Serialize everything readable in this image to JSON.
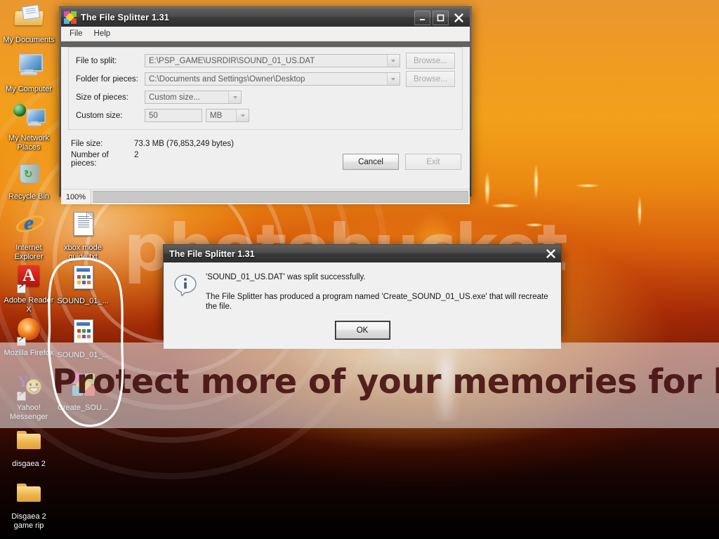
{
  "desktop": {
    "wallpaper_colors": {
      "top": "#e9972f",
      "mid": "#d8600d",
      "bottom": "#000000"
    },
    "icons": [
      {
        "label": "My Documents",
        "icon": "documents-folder-icon"
      },
      {
        "label": "My Computer",
        "icon": "computer-icon"
      },
      {
        "label": "My Network Places",
        "icon": "network-places-icon"
      },
      {
        "label": "Recycle Bin",
        "icon": "recycle-bin-icon"
      },
      {
        "label": "Internet Explorer",
        "icon": "internet-explorer-icon"
      },
      {
        "label": "Adobe Reader X",
        "icon": "adobe-reader-icon"
      },
      {
        "label": "Mozilla Firefox",
        "icon": "firefox-icon"
      },
      {
        "label": "Yahoo! Messenger",
        "icon": "yahoo-messenger-icon"
      },
      {
        "label": "disgaea 2",
        "icon": "folder-icon"
      },
      {
        "label": "Disgaea 2 game rip",
        "icon": "folder-icon"
      },
      {
        "label": "xbox mode guide.txt",
        "icon": "text-file-icon"
      },
      {
        "label": "SOUND_01_...",
        "icon": "dat-file-icon"
      },
      {
        "label": "SOUND_01_...",
        "icon": "dat-file-icon"
      },
      {
        "label": "Create_SOU...",
        "icon": "file-splitter-exe-icon"
      }
    ]
  },
  "watermark": {
    "word": "photobucket",
    "banner_text": "Protect more of your memories for less!"
  },
  "main_window": {
    "title": "The File Splitter 1.31",
    "icon": "file-splitter-icon",
    "window_buttons": {
      "minimize": "minimize-icon",
      "maximize": "maximize-icon",
      "close": "close-icon"
    },
    "menu": [
      {
        "label": "File"
      },
      {
        "label": "Help"
      }
    ],
    "fields": [
      {
        "label": "File to split:",
        "value": "E:\\PSP_GAME\\USRDIR\\SOUND_01_US.DAT",
        "control": "combo",
        "button": "Browse...",
        "disabled": true
      },
      {
        "label": "Folder for pieces:",
        "value": "C:\\Documents and Settings\\Owner\\Desktop",
        "control": "combo",
        "button": "Browse...",
        "disabled": true
      },
      {
        "label": "Size of pieces:",
        "value": "Custom size...",
        "control": "combo",
        "disabled": true
      }
    ],
    "custom_size": {
      "label": "Custom size:",
      "value": "50",
      "unit": "MB"
    },
    "status": {
      "file_size_label": "File size:",
      "file_size_value": "73.3 MB (76,853,249 bytes)",
      "pieces_label": "Number of pieces:",
      "pieces_value": "2"
    },
    "buttons": {
      "cancel": "Cancel",
      "exit": "Exit"
    },
    "progress": {
      "percent_label": "100%",
      "percent": 100
    }
  },
  "message_box": {
    "title": "The File Splitter 1.31",
    "close_icon": "close-icon",
    "info_icon": "information-icon",
    "line1": "'SOUND_01_US.DAT' was split successfully.",
    "line2": "The File Splitter has produced a program named 'Create_SOUND_01_US.exe' that will recreate the file.",
    "ok_label": "OK"
  }
}
